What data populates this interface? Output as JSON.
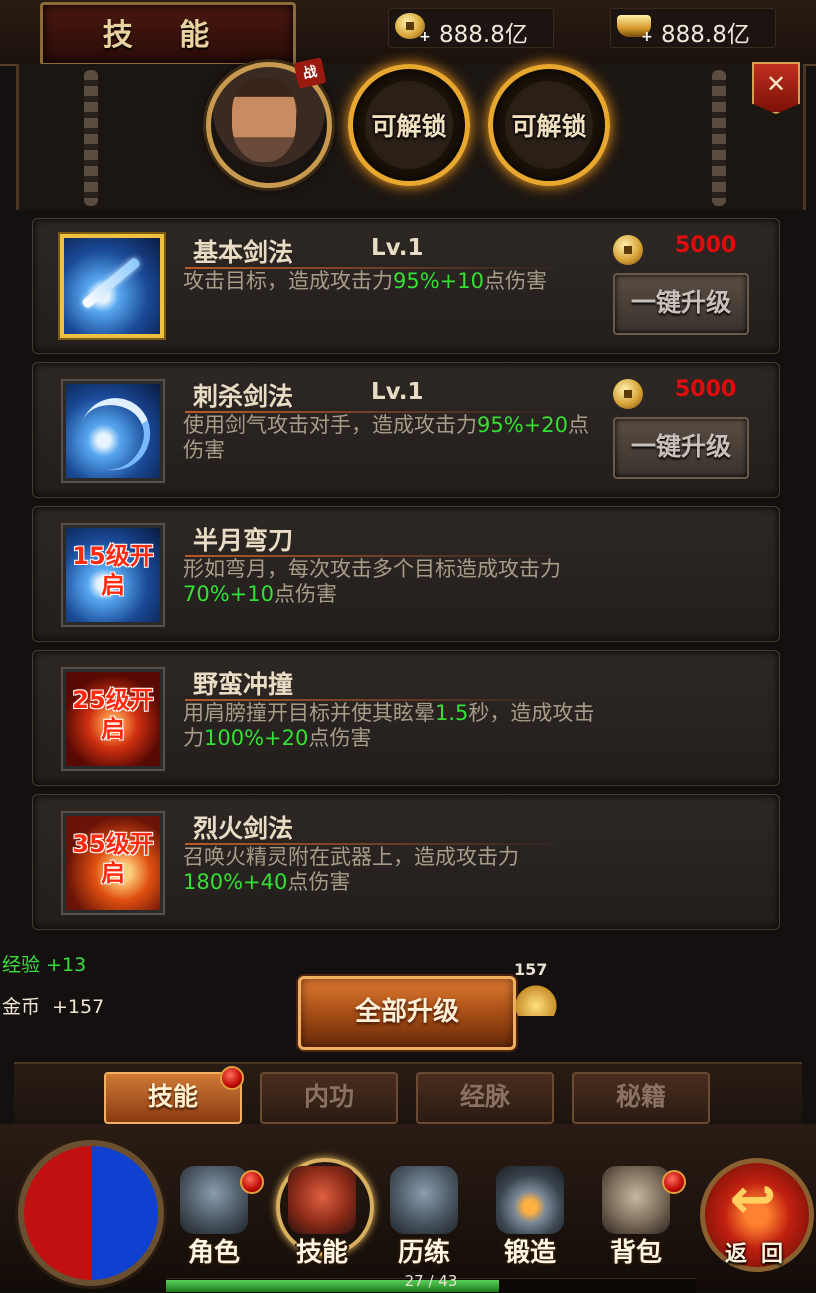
{
  "header": {
    "title": "技 能",
    "currencies": [
      {
        "icon": "coin-plus-icon",
        "value": "888.8亿"
      },
      {
        "icon": "ingot-plus-icon",
        "value": "888.8亿"
      }
    ]
  },
  "top_panel": {
    "portrait_badge": "战",
    "unlock_slots": [
      "可解锁",
      "可解锁"
    ]
  },
  "skills": [
    {
      "name": "基本剑法",
      "level": "Lv.1",
      "desc_pre": "攻击目标，造成攻击力",
      "desc_green": "95%+10",
      "desc_post": "点伤害",
      "cost": "5000",
      "upgrade_label": "一键升级",
      "selected": true
    },
    {
      "name": "刺杀剑法",
      "level": "Lv.1",
      "desc_pre": "使用剑气攻击对手，造成攻击力",
      "desc_green": "95%+20",
      "desc_post": "点伤害",
      "cost": "5000",
      "upgrade_label": "一键升级",
      "selected": false
    },
    {
      "name": "半月弯刀",
      "lock_text": "15级开启",
      "desc_pre": "形如弯月，每次攻击多个目标造成攻击力",
      "desc_green": "70%+10",
      "desc_post": "点伤害"
    },
    {
      "name": "野蛮冲撞",
      "lock_text": "25级开启",
      "desc_pre": "用肩膀撞开目标并使其眩晕",
      "desc_green": "1.5",
      "desc_mid": "秒，造成攻击力",
      "desc_green2": "100%+20",
      "desc_post": "点伤害"
    },
    {
      "name": "烈火剑法",
      "lock_text": "35级开启",
      "desc_pre": "召唤火精灵附在武器上，造成攻击力",
      "desc_green": "180%+40",
      "desc_post": "点伤害"
    }
  ],
  "gains": {
    "exp_label": "经验",
    "exp_value": "+13",
    "coin_label": "金币",
    "coin_value": "+157"
  },
  "upgrade_all": {
    "label": "全部升级",
    "coin_count": "157"
  },
  "tabs": [
    {
      "label": "技能",
      "active": true
    },
    {
      "label": "内功",
      "active": false
    },
    {
      "label": "经脉",
      "active": false
    },
    {
      "label": "秘籍",
      "active": false
    }
  ],
  "nav": [
    {
      "label": "角色",
      "icon": "armor-icon",
      "badge": true
    },
    {
      "label": "技能",
      "icon": "skill-book-icon",
      "active": true
    },
    {
      "label": "历练",
      "icon": "helmet-icon"
    },
    {
      "label": "锻造",
      "icon": "anvil-icon"
    },
    {
      "label": "背包",
      "icon": "backpack-icon",
      "badge": true
    }
  ],
  "return_label": "返回",
  "progress": {
    "text": "27 / 43",
    "current": 27,
    "total": 43
  },
  "colors": {
    "highlight_green": "#34e034",
    "cost_red": "#e00c0c",
    "gold": "#f0c040"
  }
}
